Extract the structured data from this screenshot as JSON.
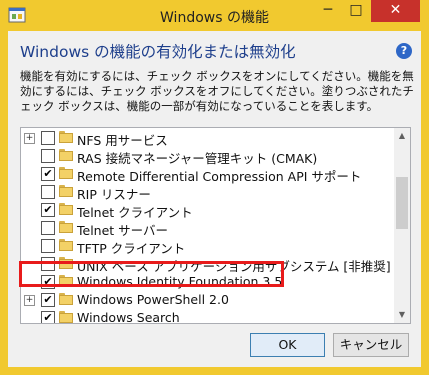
{
  "window": {
    "title": "Windows の機能",
    "min_glyph": "─",
    "max_glyph": "□",
    "close_glyph": "✕"
  },
  "dialog": {
    "heading": "Windows の機能の有効化または無効化",
    "help_glyph": "?",
    "description": "機能を有効にするには、チェック ボックスをオンにしてください。機能を無効にするには、チェック ボックスをオフにしてください。塗りつぶされたチェック ボックスは、機能の一部が有効になっていることを表します。"
  },
  "features": [
    {
      "label": "NFS 用サービス",
      "checked": false,
      "expandable": true
    },
    {
      "label": "RAS 接続マネージャー管理キット (CMAK)",
      "checked": false,
      "expandable": false
    },
    {
      "label": "Remote Differential Compression API サポート",
      "checked": true,
      "expandable": false
    },
    {
      "label": "RIP リスナー",
      "checked": false,
      "expandable": false
    },
    {
      "label": "Telnet クライアント",
      "checked": true,
      "expandable": false
    },
    {
      "label": "Telnet サーバー",
      "checked": false,
      "expandable": false
    },
    {
      "label": "TFTP クライアント",
      "checked": false,
      "expandable": false
    },
    {
      "label": "UNIX ベース アプリケーション用サブシステム [非推奨]",
      "checked": false,
      "expandable": false
    },
    {
      "label": "Windows Identity Foundation 3.5",
      "checked": true,
      "expandable": false
    },
    {
      "label": "Windows PowerShell 2.0",
      "checked": true,
      "expandable": true
    },
    {
      "label": "Windows Search",
      "checked": true,
      "expandable": false
    }
  ],
  "check_glyph": "✔",
  "expand_glyph": "+",
  "scroll": {
    "up": "▲",
    "down": "▼"
  },
  "buttons": {
    "ok": "OK",
    "cancel": "キャンセル"
  },
  "colors": {
    "title_bar": "#f1c92f",
    "heading": "#1e3f8c",
    "highlight": "#e81b1b",
    "close": "#c7312b"
  }
}
